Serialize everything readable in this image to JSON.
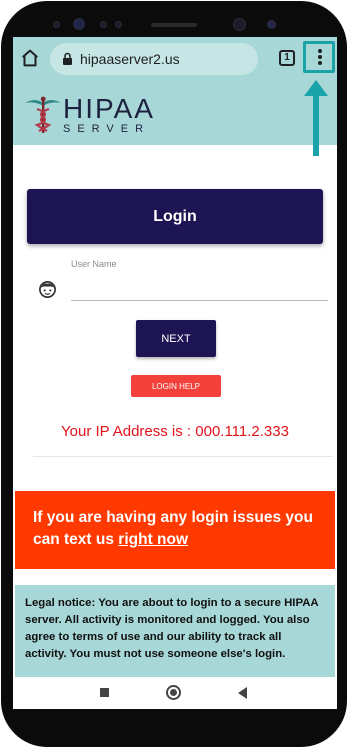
{
  "browser": {
    "url": "hipaaserver2.us",
    "tab_count": "1",
    "icons": [
      "home-icon",
      "lock-icon",
      "tabs-icon",
      "menu-icon"
    ]
  },
  "logo": {
    "wordmark": "HIPAA",
    "tagline": "SERVER"
  },
  "login": {
    "title": "Login",
    "user_label": "User Name",
    "user_value": "",
    "next_label": "NEXT",
    "help_label": "LOGIN HELP"
  },
  "ip": {
    "text": "Your IP Address is : 000.111.2.333"
  },
  "alert": {
    "text": "If you are having any login issues you can text us",
    "link": "right now"
  },
  "legal": {
    "text": "Legal notice: You are about to login to a secure HIPAA server. All activity is monitored and logged. You also agree to terms of use and our ability to track all activity. You must not use someone else's login."
  },
  "colors": {
    "brand_navy": "#1d1553",
    "teal_banner": "#a7d7d6",
    "alert_orange": "#ff3900",
    "ip_red": "#e0141c",
    "help_red": "#f2413b",
    "highlight_teal": "#1aa3a8"
  }
}
